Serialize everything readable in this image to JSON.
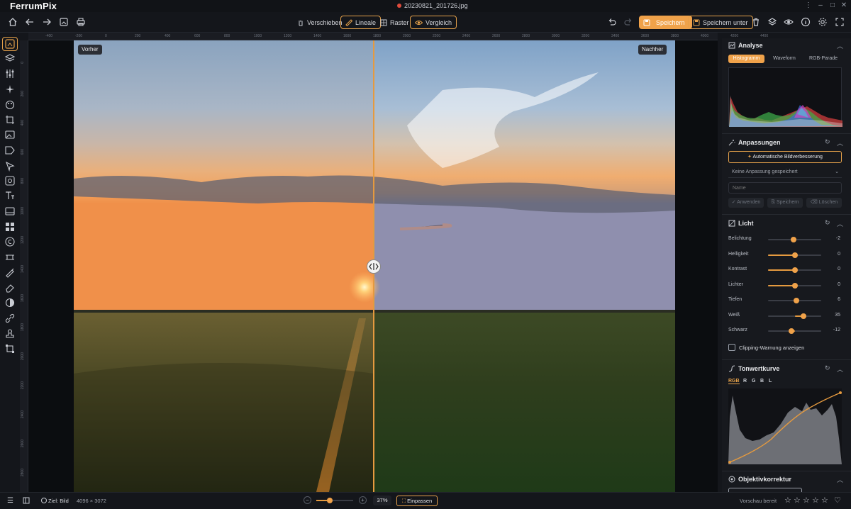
{
  "app": {
    "name": "FerrumPix",
    "file_name": "20230821_201726.jpg"
  },
  "toolbar": {
    "move_label": "Verschieben",
    "rulers_label": "Lineale",
    "grid_label": "Raster",
    "compare_label": "Vergleich",
    "save_label": "Speichern",
    "save_as_label": "Speichern unter"
  },
  "canvas": {
    "before_label": "Vorher",
    "after_label": "Nachher",
    "ruler_top_ticks": [
      "-400",
      "-200",
      "0",
      "200",
      "400",
      "600",
      "800",
      "1000",
      "1200",
      "1400",
      "1600",
      "1800",
      "2000",
      "2200",
      "2400",
      "2600",
      "2800",
      "3000",
      "3200",
      "3400",
      "3600",
      "3800",
      "4000",
      "4200",
      "4400"
    ],
    "ruler_left_ticks": [
      "0",
      "200",
      "400",
      "600",
      "800",
      "1000",
      "1200",
      "1400",
      "1600",
      "1800",
      "2000",
      "2200",
      "2400",
      "2600",
      "2800",
      "3000"
    ]
  },
  "analysis": {
    "title": "Analyse",
    "tabs": [
      "Histogramm",
      "Waveform",
      "RGB-Parade"
    ],
    "active_tab": "Histogramm"
  },
  "adjustments": {
    "title": "Anpassungen",
    "auto_button": "Automatische Bildverbesserung",
    "preset_select": "Keine Anpassung gespeichert",
    "name_placeholder": "Name",
    "apply_label": "Anwenden",
    "save_label": "Speichern",
    "delete_label": "Löschen"
  },
  "light": {
    "title": "Licht",
    "sliders": [
      {
        "label": "Belichtung",
        "value": "-2",
        "level": 0.48
      },
      {
        "label": "Helligkeit",
        "value": "0",
        "level": 0.5
      },
      {
        "label": "Kontrast",
        "value": "0",
        "level": 0.5
      },
      {
        "label": "Lichter",
        "value": "0",
        "level": 0.5
      },
      {
        "label": "Tiefen",
        "value": "6",
        "level": 0.53
      },
      {
        "label": "Weiß",
        "value": "35",
        "level": 0.67
      },
      {
        "label": "Schwarz",
        "value": "-12",
        "level": 0.44
      }
    ],
    "clipping_label": "Clipping-Warnung anzeigen"
  },
  "tone_curve": {
    "title": "Tonwertkurve",
    "channels": [
      "RGB",
      "R",
      "G",
      "B",
      "L"
    ],
    "active_channel": "RGB"
  },
  "lens": {
    "title": "Objektivkorrektur"
  },
  "status": {
    "target_label": "Ziel: Bild",
    "dimensions": "4096 × 3072",
    "zoom_value": "37%",
    "fit_label": "Einpassen",
    "preview_status": "Vorschau bereit"
  },
  "colors": {
    "accent": "#f0a24a",
    "bg": "#14161b",
    "panel": "#17191e"
  }
}
